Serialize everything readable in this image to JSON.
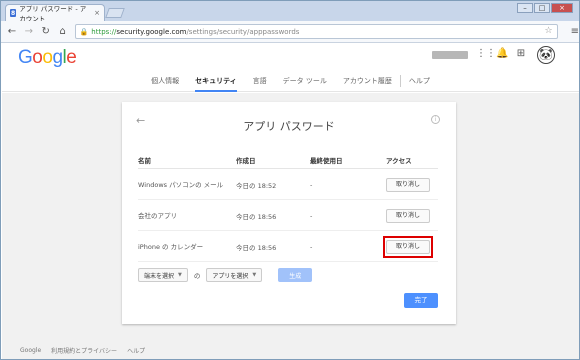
{
  "browser": {
    "tab_title": "アプリ パスワード - アカウント",
    "url_scheme": "https://",
    "url_host": "security.google.com",
    "url_path": "/settings/security/apppasswords"
  },
  "header": {
    "logo": [
      "G",
      "o",
      "o",
      "g",
      "l",
      "e"
    ],
    "nav": [
      "個人情報",
      "セキュリティ",
      "言語",
      "データ ツール",
      "アカウント履歴",
      "ヘルプ"
    ]
  },
  "card": {
    "title": "アプリ パスワード",
    "columns": [
      "名前",
      "作成日",
      "最終使用日",
      "アクセス"
    ],
    "rows": [
      {
        "name": "Windows パソコンの メール",
        "created": "今日の 18:52",
        "last_used": "-",
        "action": "取り消し"
      },
      {
        "name": "会社のアプリ",
        "created": "今日の 18:56",
        "last_used": "-",
        "action": "取り消し"
      },
      {
        "name": "iPhone の カレンダー",
        "created": "今日の 18:56",
        "last_used": "-",
        "action": "取り消し"
      }
    ],
    "device_select": "端末を選択",
    "of_label": "の",
    "app_select": "アプリを選択",
    "generate_label": "生成",
    "done_label": "完了"
  },
  "footer": [
    "Google",
    "利用規約とプライバシー",
    "ヘルプ"
  ],
  "colors": {
    "accent": "#4285f4",
    "highlight": "#dd0000",
    "button_blue": "#4d90fe"
  }
}
